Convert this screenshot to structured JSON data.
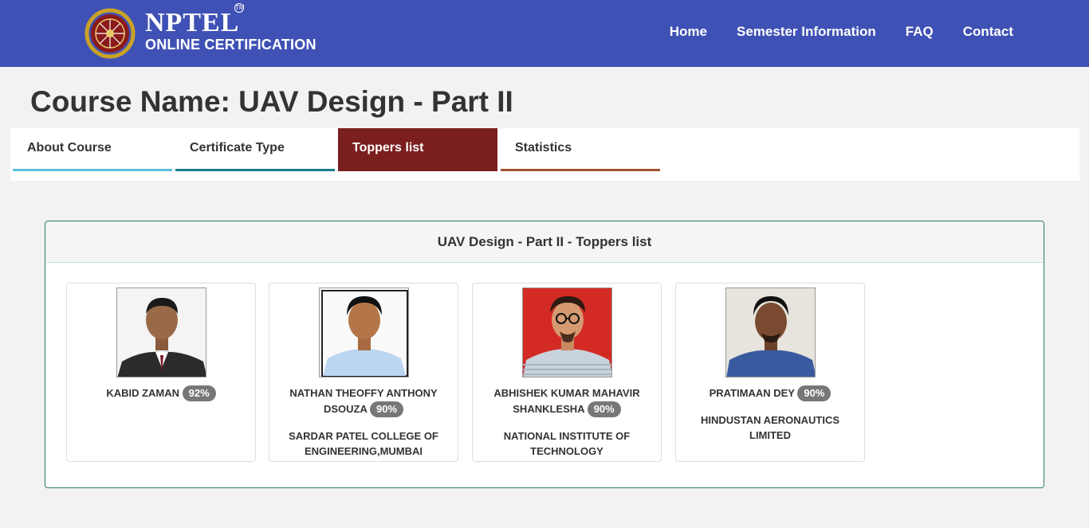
{
  "header": {
    "logo_title": "NPTEL",
    "logo_tm": "TM",
    "logo_subtitle": "ONLINE CERTIFICATION",
    "nav": [
      "Home",
      "Semester Information",
      "FAQ",
      "Contact"
    ]
  },
  "course_title": "Course Name: UAV Design - Part II",
  "tabs": [
    "About Course",
    "Certificate Type",
    "Toppers list",
    "Statistics"
  ],
  "panel_title": "UAV Design - Part II - Toppers list",
  "toppers": [
    {
      "name": "KABID ZAMAN",
      "score": "92%",
      "institution": ""
    },
    {
      "name": "NATHAN THEOFFY ANTHONY DSOUZA",
      "score": "90%",
      "institution": "SARDAR PATEL COLLEGE OF ENGINEERING,MUMBAI"
    },
    {
      "name": "ABHISHEK KUMAR MAHAVIR SHANKLESHA",
      "score": "90%",
      "institution": "NATIONAL INSTITUTE OF TECHNOLOGY"
    },
    {
      "name": "PRATIMAAN DEY",
      "score": "90%",
      "institution": "HINDUSTAN AERONAUTICS LIMITED"
    }
  ],
  "colors": {
    "header_bg": "#3f51b5",
    "active_tab": "#7b1e1e",
    "badge": "#777777"
  }
}
